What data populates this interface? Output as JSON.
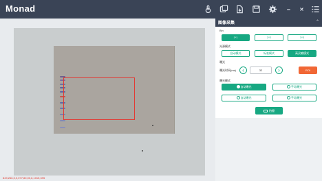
{
  "app": {
    "logo": "Monad"
  },
  "toolbar": {
    "icons": [
      "thermometer-icon",
      "copy-icon",
      "export-icon",
      "save-icon",
      "settings-icon",
      "minimize-icon",
      "close-icon",
      "menu-icon"
    ]
  },
  "viewer": {
    "coordinates": "849,266,0,0,077,80,00,6,1015,395"
  },
  "panel": {
    "title": "图像采集",
    "bin": {
      "label": "Bin",
      "options": [
        "1*1",
        "2*2",
        "3*3"
      ],
      "selected": "1*1"
    },
    "light_mode": {
      "label": "光源模式",
      "options": [
        "自动模式",
        "标准模式",
        "高灵敏模式"
      ],
      "selected": "高灵敏模式"
    },
    "exposure": {
      "section_label": "曝光",
      "field_label": "曝光时间(ms)",
      "value": "32",
      "roi_label": "ROI"
    },
    "exposure_mode": {
      "label": "曝光模式",
      "options": [
        "自动曝光",
        "手动曝光",
        "自动曝光",
        "手动曝光"
      ]
    },
    "capture_label": "拍摄"
  },
  "colors": {
    "accent": "#17a882",
    "topbar": "#3a4456",
    "roi_button": "#f16735",
    "roi_box": "#e23a34"
  }
}
